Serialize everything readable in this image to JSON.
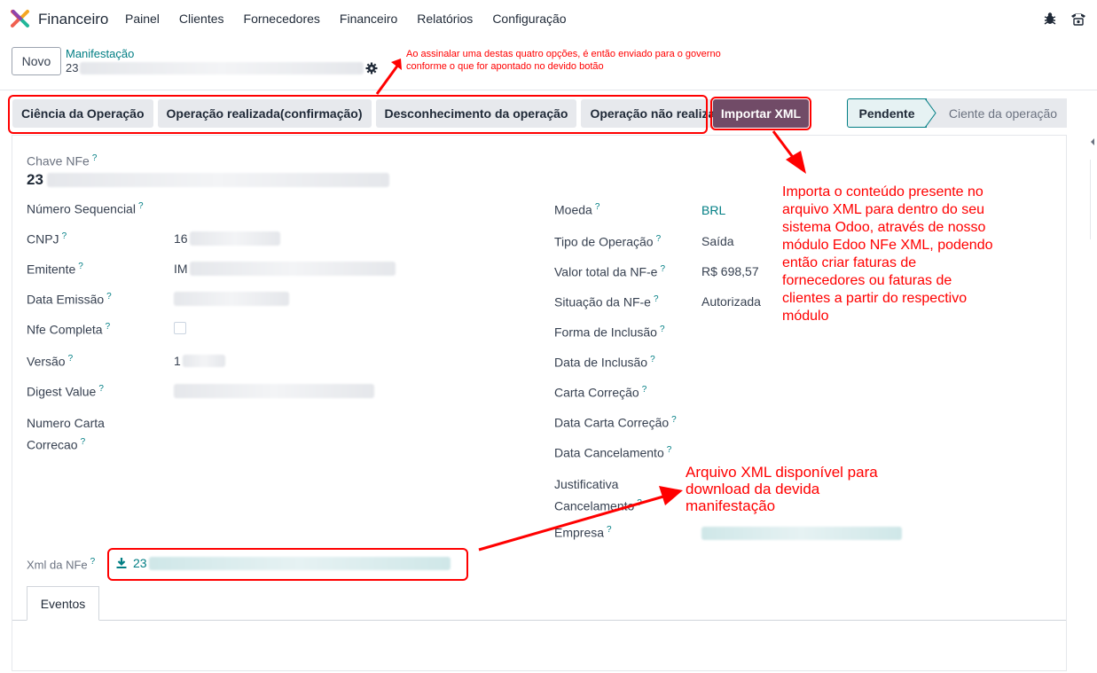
{
  "navbar": {
    "app_name": "Financeiro",
    "menu": [
      "Painel",
      "Clientes",
      "Fornecedores",
      "Financeiro",
      "Relatórios",
      "Configuração"
    ]
  },
  "control_panel": {
    "new_label": "Novo",
    "breadcrumb": "Manifestação",
    "record_prefix": "23"
  },
  "annotations": {
    "top": "Ao assinalar uma destas quatro opções, é então enviado para o governo conforme o que for apontado no devido botão",
    "import": "Importa o conteúdo presente no arquivo XML para dentro do seu sistema Odoo, através de nosso módulo Edoo NFe XML, podendo então criar faturas de fornecedores ou faturas de clientes a partir do respectivo módulo",
    "xml": "Arquivo XML disponível para download da devida manifestação"
  },
  "actions": [
    "Ciência da Operação",
    "Operação realizada(confirmação)",
    "Desconhecimento da operação",
    "Operação não realizada"
  ],
  "import_label": "Importar XML",
  "statusbar": {
    "current": "Pendente",
    "next": "Ciente da operação"
  },
  "form": {
    "chave_label": "Chave NFe",
    "chave_prefix": "23",
    "left": {
      "numero_sequencial": "Número Sequencial",
      "cnpj": "CNPJ",
      "cnpj_prefix": "16",
      "emitente": "Emitente",
      "emitente_prefix": "IM",
      "data_emissao": "Data Emissão",
      "nfe_completa": "Nfe Completa",
      "versao": "Versão",
      "versao_prefix": "1",
      "digest_value": "Digest Value",
      "numero_carta_1": "Numero Carta",
      "numero_carta_2": "Correcao"
    },
    "right": {
      "moeda": "Moeda",
      "moeda_val": "BRL",
      "tipo_operacao": "Tipo de Operação",
      "tipo_operacao_val": "Saída",
      "valor_total": "Valor total da NF-e",
      "valor_total_val": "R$ 698,57",
      "situacao": "Situação da NF-e",
      "situacao_val": "Autorizada",
      "forma_inclusao": "Forma de Inclusão",
      "data_inclusao": "Data de Inclusão",
      "carta_correcao": "Carta Correção",
      "data_carta": "Data Carta Correção",
      "data_cancelamento": "Data Cancelamento",
      "justificativa_1": "Justificativa",
      "justificativa_2": "Cancelamento",
      "empresa": "Empresa"
    },
    "xml_label": "Xml da NFe",
    "xml_prefix": "23",
    "tooltip_mark": "?"
  },
  "tabs": {
    "eventos": "Eventos"
  },
  "colors": {
    "brand": "#714b67",
    "accent": "#017e84",
    "annotation": "#ff0000"
  }
}
